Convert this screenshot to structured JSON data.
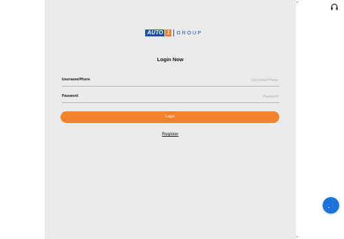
{
  "logo": {
    "auto": "AUTO",
    "one": "1",
    "group": "GROUP"
  },
  "form": {
    "title": "Login Now",
    "username_label": "Username/Phone",
    "username_placeholder": "Username/Phone",
    "username_value": "",
    "password_label": "Password",
    "password_placeholder": "Password",
    "password_value": "",
    "login_label": "Login",
    "register_label": "Register"
  },
  "colors": {
    "accent": "#f4822b",
    "brand_blue": "#1e4fa8",
    "chat_button": "#1a73d9",
    "panel_background": "#ebebeb"
  },
  "icons": {
    "support": "headset-icon",
    "chat": "chat-bubble-icon",
    "scroll_up": "triangle-up-icon",
    "scroll_down": "triangle-down-icon"
  }
}
